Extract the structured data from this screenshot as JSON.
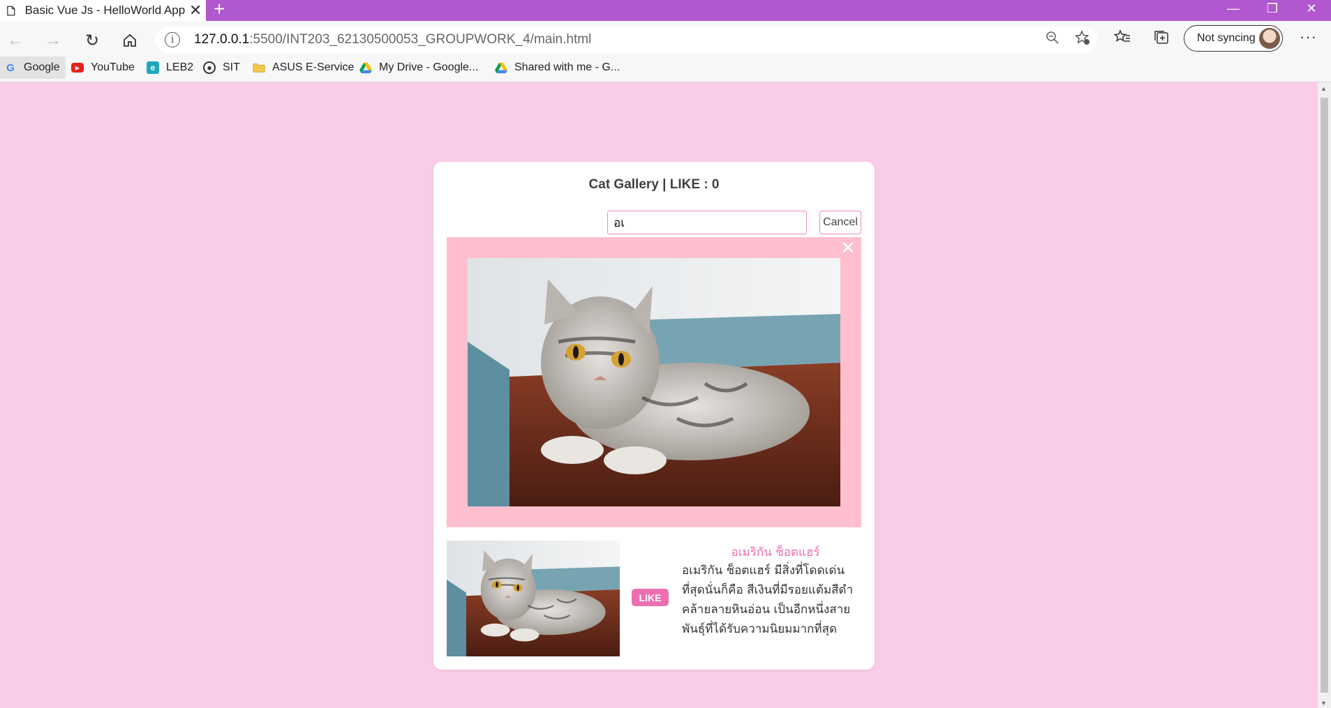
{
  "browser": {
    "tab_title": "Basic Vue Js - HelloWorld App",
    "tab_close": "✕",
    "new_tab": "+",
    "url_host": "127.0.0.1",
    "url_path": ":5500/INT203_62130500053_GROUPWORK_4/main.html",
    "profile_label": "Not syncing",
    "bookmarks": [
      {
        "label": "Google",
        "icon": "google-icon"
      },
      {
        "label": "YouTube",
        "icon": "youtube-icon"
      },
      {
        "label": "LEB2",
        "icon": "leb2-icon"
      },
      {
        "label": "SIT",
        "icon": "sit-icon"
      },
      {
        "label": "ASUS E-Service",
        "icon": "folder-icon"
      },
      {
        "label": "My Drive - Google...",
        "icon": "drive-icon"
      },
      {
        "label": "Shared with me - G...",
        "icon": "drive-icon"
      }
    ]
  },
  "gallery": {
    "title": "Cat Gallery | LIKE : 0",
    "search_value": "อเ",
    "cancel_label": "Cancel",
    "close_symbol": "✕",
    "like_label": "LIKE",
    "cat_name": "อเมริกัน ช็อตแฮร์",
    "cat_description": "อเมริกัน ช็อตแฮร์ มีสิ่งที่โดดเด่นที่สุดนั่นก็คือ สีเงินที่มีรอยแต้มสีดำคล้ายลายหินอ่อน เป็นอีกหนึ่งสายพันธุ์ที่ได้รับความนิยมมากที่สุด"
  },
  "colors": {
    "page_background": "#f9cde7",
    "titlebar": "#b157cf",
    "viewer_background": "#ffbfcf",
    "accent_pink": "#ec6fb1"
  }
}
